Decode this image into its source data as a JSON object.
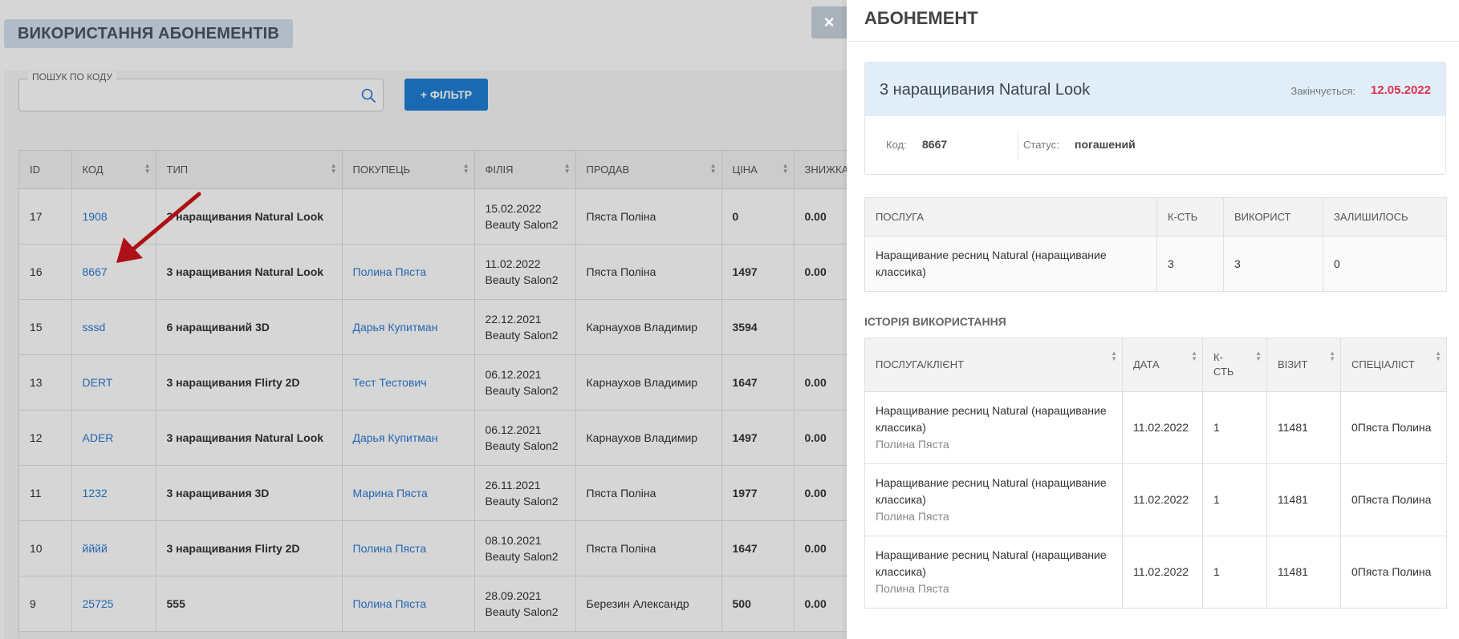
{
  "page": {
    "title": "ВИКОРИСТАННЯ АБОНЕМЕНТІВ",
    "search": {
      "label": "ПОШУК ПО КОДУ",
      "value": "",
      "placeholder": ""
    },
    "filter_button": "+ ФІЛЬТР",
    "table": {
      "columns": [
        "ID",
        "КОД",
        "ТИП",
        "ПОКУПЕЦЬ",
        "ФІЛІЯ",
        "ПРОДАВ",
        "ЦІНА",
        "ЗНИЖКА"
      ],
      "rows": [
        {
          "id": "17",
          "code": "1908",
          "type": "3 наращивания Natural Look",
          "buyer": "",
          "date": "15.02.2022",
          "branch": "Beauty Salon2",
          "seller": "Пяста Поліна",
          "price": "0",
          "discount": "0.00"
        },
        {
          "id": "16",
          "code": "8667",
          "type": "3 наращивания Natural Look",
          "buyer": "Полина Пяста",
          "date": "11.02.2022",
          "branch": "Beauty Salon2",
          "seller": "Пяста Поліна",
          "price": "1497",
          "discount": "0.00"
        },
        {
          "id": "15",
          "code": "sssd",
          "type": "6 наращиваний 3D",
          "buyer": "Дарья Купитман",
          "date": "22.12.2021",
          "branch": "Beauty Salon2",
          "seller": "Карнаухов Владимир",
          "price": "3594",
          "discount": ""
        },
        {
          "id": "13",
          "code": "DERT",
          "type": "3 наращивания Flirty 2D",
          "buyer": "Тест Тестович",
          "date": "06.12.2021",
          "branch": "Beauty Salon2",
          "seller": "Карнаухов Владимир",
          "price": "1647",
          "discount": "0.00"
        },
        {
          "id": "12",
          "code": "ADER",
          "type": "3 наращивания Natural Look",
          "buyer": "Дарья Купитман",
          "date": "06.12.2021",
          "branch": "Beauty Salon2",
          "seller": "Карнаухов Владимир",
          "price": "1497",
          "discount": "0.00"
        },
        {
          "id": "11",
          "code": "1232",
          "type": "3 наращивания 3D",
          "buyer": "Марина Пяста",
          "date": "26.11.2021",
          "branch": "Beauty Salon2",
          "seller": "Пяста Поліна",
          "price": "1977",
          "discount": "0.00"
        },
        {
          "id": "10",
          "code": "йййй",
          "type": "3 наращивания Flirty 2D",
          "buyer": "Полина Пяста",
          "date": "08.10.2021",
          "branch": "Beauty Salon2",
          "seller": "Пяста Поліна",
          "price": "1647",
          "discount": "0.00"
        },
        {
          "id": "9",
          "code": "25725",
          "type": "555",
          "buyer": "Полина Пяста",
          "date": "28.09.2021",
          "branch": "Beauty Salon2",
          "seller": "Березин Александр",
          "price": "500",
          "discount": "0.00"
        }
      ]
    }
  },
  "close_label": "×",
  "panel": {
    "title": "АБОНЕМЕНТ",
    "subscription_name": "3 наращивания Natural Look",
    "expires_label": "Закінчується:",
    "expires_date": "12.05.2022",
    "code_label": "Код:",
    "code_value": "8667",
    "status_label": "Статус:",
    "status_value": "погашений",
    "services": {
      "columns": [
        "ПОСЛУГА",
        "К-СТЬ",
        "ВИКОРИСТ",
        "ЗАЛИШИЛОСЬ"
      ],
      "rows": [
        {
          "service": "Наращивание ресниц Natural (наращивание классика)",
          "qty": "3",
          "used": "3",
          "left": "0"
        }
      ]
    },
    "history_title": "ІСТОРІЯ ВИКОРИСТАННЯ",
    "history": {
      "columns": [
        "ПОСЛУГА/КЛІЄНТ",
        "ДАТА",
        "К-СТЬ",
        "ВІЗИТ",
        "СПЕЦІАЛІСТ"
      ],
      "rows": [
        {
          "service": "Наращивание ресниц Natural (наращивание классика)",
          "client": "Полина Пяста",
          "date": "11.02.2022",
          "qty": "1",
          "visit": "11481",
          "specialist": "0Пяста Полина"
        },
        {
          "service": "Наращивание ресниц Natural (наращивание классика)",
          "client": "Полина Пяста",
          "date": "11.02.2022",
          "qty": "1",
          "visit": "11481",
          "specialist": "0Пяста Полина"
        },
        {
          "service": "Наращивание ресниц Natural (наращивание классика)",
          "client": "Полина Пяста",
          "date": "11.02.2022",
          "qty": "1",
          "visit": "11481",
          "specialist": "0Пяста Полина"
        }
      ]
    }
  },
  "colors": {
    "accent": "#1e7fd6",
    "link": "#2a7ad6",
    "expires": "#e0334d",
    "arrow": "#d0141c"
  },
  "icons": {
    "search": "search-icon",
    "close": "close-icon",
    "sort": "sort-icon",
    "arrow": "red-arrow-annotation"
  }
}
